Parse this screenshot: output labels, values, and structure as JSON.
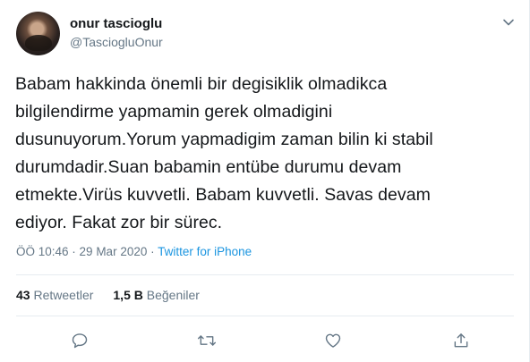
{
  "author": {
    "display_name": "onur tascioglu",
    "handle": "@TasciogluOnur",
    "avatar_icon": "profile-photo"
  },
  "tweet": {
    "text": "Babam hakkinda önemli bir degisiklik olmadikca\nbilgilendirme yapmamin gerek olmadigini\ndusunuyorum.Yorum yapmadigim zaman bilin ki stabil\ndurumdadir.Suan babamin entübe durumu devam\netmekte.Virüs kuvvetli. Babam kuvvetli. Savas devam\nediyor. Fakat zor bir sürec.",
    "time": "ÖÖ 10:46",
    "separator": " · ",
    "date": "29 Mar 2020",
    "source": "Twitter for iPhone"
  },
  "stats": {
    "retweets_count": "43",
    "retweets_label": "Retweetler",
    "likes_count": "1,5 B",
    "likes_label": "Beğeniler"
  },
  "icons": {
    "reply": "reply-icon",
    "retweet": "retweet-icon",
    "like": "heart-icon",
    "share": "share-icon",
    "more": "chevron-down-icon"
  },
  "colors": {
    "text": "#14171a",
    "secondary": "#657786",
    "link": "#1b95e0",
    "divider": "#e6ecf0"
  }
}
